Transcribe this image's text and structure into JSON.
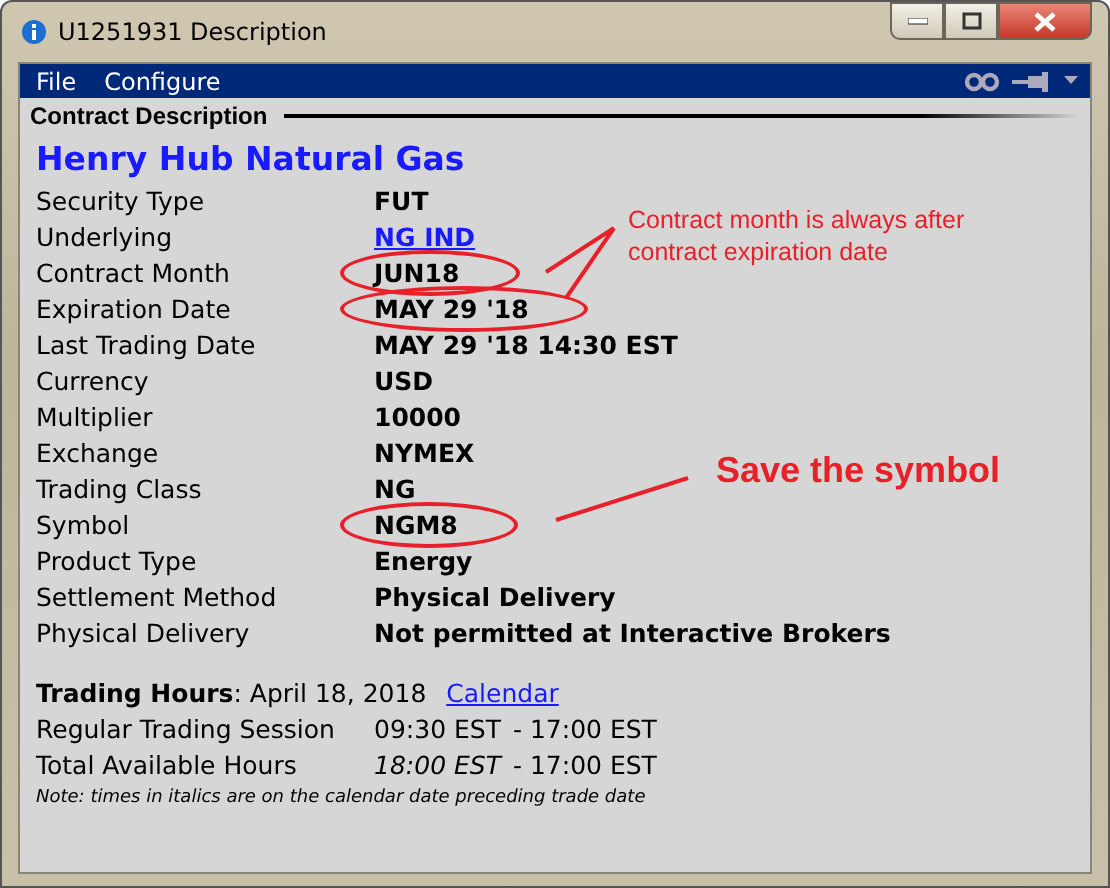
{
  "window": {
    "title": "U1251931 Description"
  },
  "menu": [
    {
      "label": "File"
    },
    {
      "label": "Configure"
    }
  ],
  "section_title": "Contract Description",
  "contract_name": "Henry Hub Natural Gas",
  "fields": [
    {
      "label": "Security Type",
      "value": "FUT",
      "kind": "text",
      "circled": false
    },
    {
      "label": "Underlying",
      "value": "NG IND",
      "kind": "link",
      "circled": false
    },
    {
      "label": "Contract Month",
      "value": "JUN18",
      "kind": "text",
      "circled": true
    },
    {
      "label": "Expiration Date",
      "value": "MAY 29 '18",
      "kind": "text",
      "circled": true
    },
    {
      "label": "Last Trading Date",
      "value": "MAY 29 '18 14:30 EST",
      "kind": "text",
      "circled": false
    },
    {
      "label": "Currency",
      "value": "USD",
      "kind": "text",
      "circled": false
    },
    {
      "label": "Multiplier",
      "value": "10000",
      "kind": "text",
      "circled": false
    },
    {
      "label": "Exchange",
      "value": "NYMEX",
      "kind": "text",
      "circled": false
    },
    {
      "label": "Trading Class",
      "value": "NG",
      "kind": "text",
      "circled": false
    },
    {
      "label": "Symbol",
      "value": "NGM8",
      "kind": "text",
      "circled": true
    },
    {
      "label": "Product Type",
      "value": "Energy",
      "kind": "text",
      "circled": false
    },
    {
      "label": "Settlement Method",
      "value": "Physical Delivery",
      "kind": "text",
      "circled": false
    },
    {
      "label": "Physical Delivery",
      "value": "Not permitted at Interactive Brokers",
      "kind": "text",
      "circled": false
    }
  ],
  "trading_hours": {
    "label": "Trading Hours",
    "date": ": April 18, 2018",
    "link": "Calendar"
  },
  "sessions": [
    {
      "label": "Regular Trading Session",
      "parts": [
        {
          "text": "09:30 EST",
          "italic": false
        },
        {
          "text": "- 17:00 EST",
          "italic": false
        }
      ]
    },
    {
      "label": "Total Available Hours",
      "parts": [
        {
          "text": "18:00 EST",
          "italic": true
        },
        {
          "text": "- 17:00 EST",
          "italic": false
        }
      ]
    }
  ],
  "note": "Note: times in italics are on the calendar date preceding trade date",
  "annotations": [
    {
      "text": "Contract month is always after contract expiration date",
      "kind": "small"
    },
    {
      "text": "Save the symbol",
      "kind": "large"
    }
  ]
}
